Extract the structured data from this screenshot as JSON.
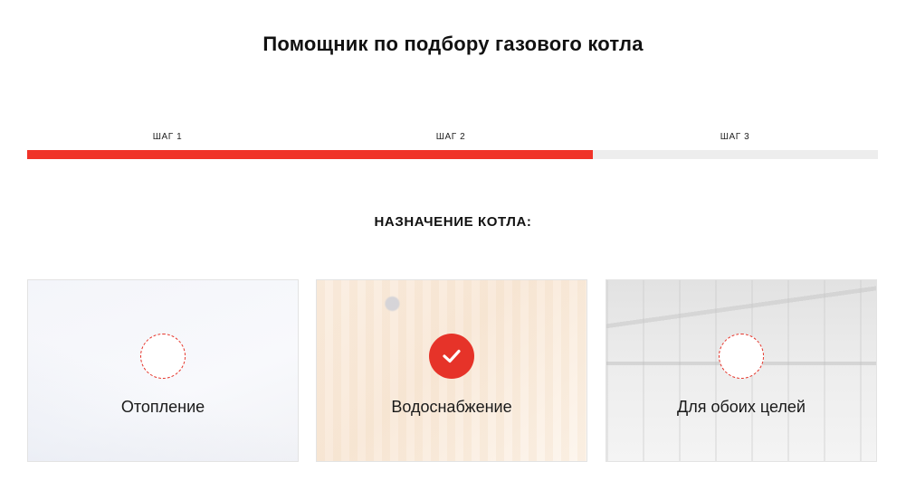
{
  "header": {
    "title": "Помощник по подбору газового котла"
  },
  "progress": {
    "steps": [
      "ШАГ 1",
      "ШАГ 2",
      "ШАГ 3"
    ],
    "completed_fraction": 0.665,
    "accent_color": "#f03328",
    "track_color": "#ededed"
  },
  "question": {
    "heading": "НАЗНАЧЕНИЕ КОТЛА:"
  },
  "options": [
    {
      "label": "Отопление",
      "selected": false,
      "icon": "radio-empty-icon"
    },
    {
      "label": "Водоснабжение",
      "selected": true,
      "icon": "checkmark-icon"
    },
    {
      "label": "Для обоих целей",
      "selected": false,
      "icon": "radio-empty-icon"
    }
  ],
  "colors": {
    "selected": "#e63329"
  }
}
